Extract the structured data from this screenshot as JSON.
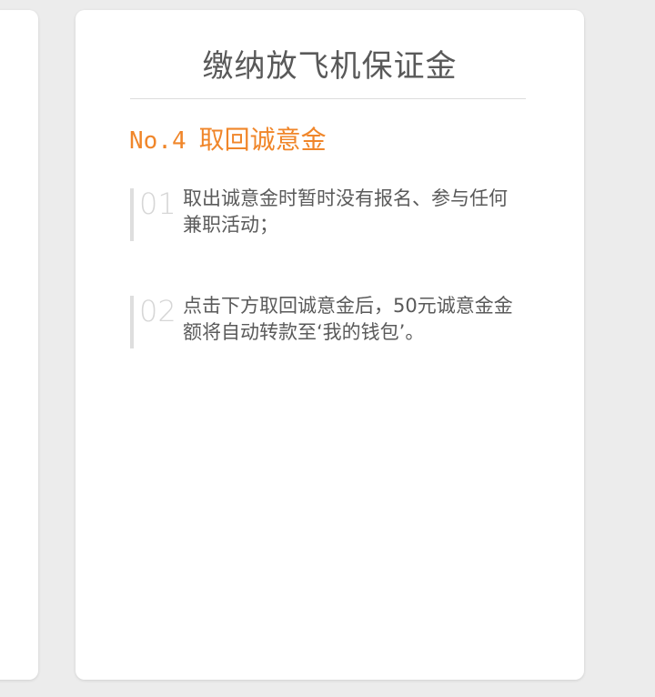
{
  "card": {
    "title": "缴纳放飞机保证金",
    "section": {
      "number": "No.4",
      "label": "取回诚意金"
    },
    "steps": [
      {
        "num": "01",
        "text": "取出诚意金时暂时没有报名、参与任何兼职活动；"
      },
      {
        "num": "02",
        "text": "点击下方取回诚意金后，50元诚意金金额将自动转款至‘我的钱包’。"
      }
    ]
  },
  "colors": {
    "background": "#ececec",
    "card": "#ffffff",
    "accent": "#f0862a",
    "title": "#595959",
    "muted_number": "#d6d6d6"
  }
}
